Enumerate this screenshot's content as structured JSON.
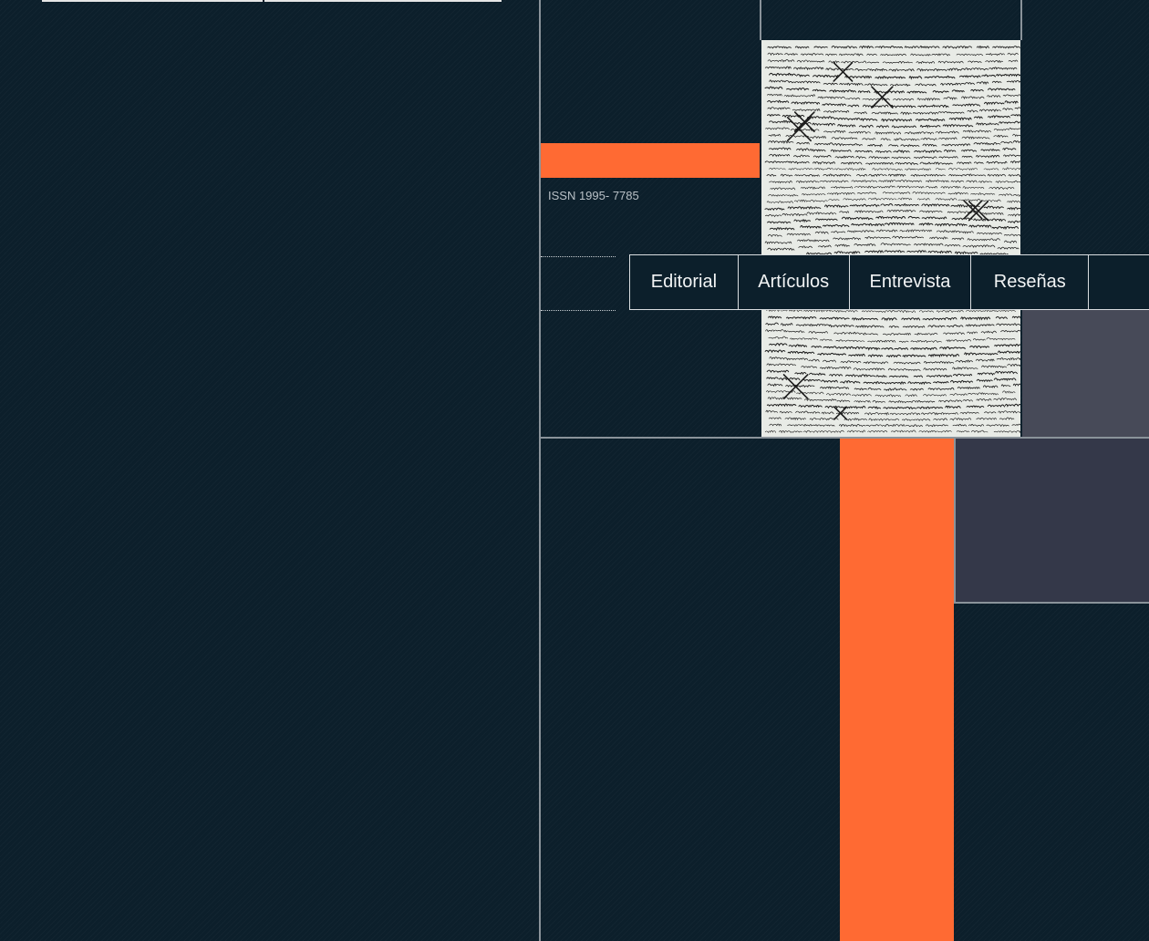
{
  "header": {
    "issn": "ISSN 1995- 7785"
  },
  "nav": {
    "items": [
      {
        "label": "Editorial"
      },
      {
        "label": "Artículos"
      },
      {
        "label": "Entrevista"
      },
      {
        "label": "Reseñas"
      },
      {
        "label": ""
      }
    ]
  },
  "cover": {
    "description_icon": "handwritten-manuscript-image"
  },
  "colors": {
    "background": "#0c1f2b",
    "accent_orange": "#ff6a33",
    "slate": "#474a58",
    "slate_dark": "#343849",
    "rule": "#8a939a"
  }
}
